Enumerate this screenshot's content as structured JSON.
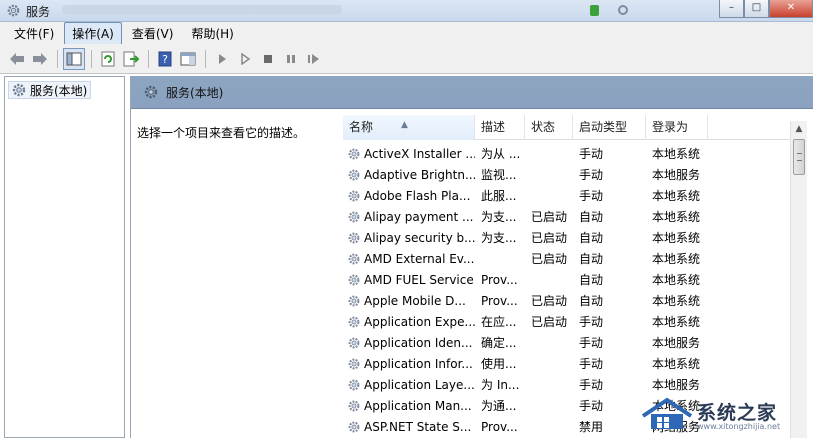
{
  "window": {
    "title": "服务",
    "buttons": {
      "minimize": "–",
      "maximize": "□",
      "close": "✕"
    }
  },
  "menu": [
    "文件(F)",
    "操作(A)",
    "查看(V)",
    "帮助(H)"
  ],
  "menu_active_index": 1,
  "toolbar": {
    "icons": [
      "back-arrow-icon",
      "forward-arrow-icon",
      "console-tree-icon",
      "refresh-icon",
      "export-list-icon",
      "help-icon",
      "properties-pane-icon",
      "play-icon",
      "play-outline-icon",
      "stop-icon",
      "pause-icon",
      "restart-icon"
    ]
  },
  "tree": {
    "item": "服务(本地)"
  },
  "content": {
    "header_title": "服务(本地)",
    "description_prompt": "选择一个项目来查看它的描述。"
  },
  "list": {
    "columns": [
      "名称",
      "描述",
      "状态",
      "启动类型",
      "登录为"
    ],
    "sorted_column": "名称",
    "rows": [
      {
        "name": "ActiveX Installer ...",
        "desc": "为从 ...",
        "status": "",
        "startup": "手动",
        "logon": "本地系统"
      },
      {
        "name": "Adaptive Brightn...",
        "desc": "监视...",
        "status": "",
        "startup": "手动",
        "logon": "本地服务"
      },
      {
        "name": "Adobe Flash Pla...",
        "desc": "此服...",
        "status": "",
        "startup": "手动",
        "logon": "本地系统"
      },
      {
        "name": "Alipay payment ...",
        "desc": "为支...",
        "status": "已启动",
        "startup": "自动",
        "logon": "本地系统"
      },
      {
        "name": "Alipay security b...",
        "desc": "为支...",
        "status": "已启动",
        "startup": "自动",
        "logon": "本地系统"
      },
      {
        "name": "AMD External Ev...",
        "desc": "",
        "status": "已启动",
        "startup": "自动",
        "logon": "本地系统"
      },
      {
        "name": "AMD FUEL Service",
        "desc": "Prov...",
        "status": "",
        "startup": "自动",
        "logon": "本地系统"
      },
      {
        "name": "Apple Mobile D...",
        "desc": "Prov...",
        "status": "已启动",
        "startup": "自动",
        "logon": "本地系统"
      },
      {
        "name": "Application Expe...",
        "desc": "在应...",
        "status": "已启动",
        "startup": "手动",
        "logon": "本地系统"
      },
      {
        "name": "Application Iden...",
        "desc": "确定...",
        "status": "",
        "startup": "手动",
        "logon": "本地服务"
      },
      {
        "name": "Application Infor...",
        "desc": "使用...",
        "status": "",
        "startup": "手动",
        "logon": "本地系统"
      },
      {
        "name": "Application Laye...",
        "desc": "为 In...",
        "status": "",
        "startup": "手动",
        "logon": "本地服务"
      },
      {
        "name": "Application Man...",
        "desc": "为通...",
        "status": "",
        "startup": "手动",
        "logon": "本地系统"
      },
      {
        "name": "ASP.NET State S...",
        "desc": "Prov...",
        "status": "",
        "startup": "禁用",
        "logon": "网络服务"
      }
    ]
  },
  "watermark": {
    "text": "系统之家",
    "url": "www.xitongzhijia.net"
  },
  "colors": {
    "header_band": "#8ea5c1",
    "accent": "#3d6bb3"
  }
}
